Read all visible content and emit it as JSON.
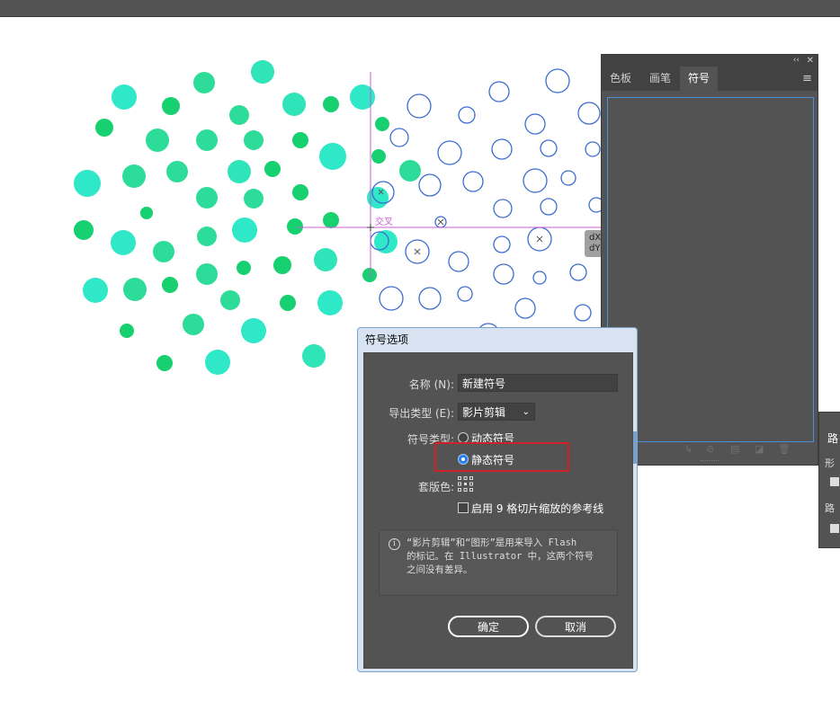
{
  "canvas": {
    "smart_guide_label": "交叉"
  },
  "dx_tooltip": {
    "dx": "dX",
    "dy": "dY"
  },
  "panel": {
    "tabs": [
      {
        "label": "色板"
      },
      {
        "label": "画笔"
      },
      {
        "label": "符号",
        "active": true
      }
    ],
    "collapse_icon": "double-chevron-left-icon",
    "close_icon": "close-icon",
    "menu_icon": "hamburger-menu-icon",
    "footer_icons": [
      "place-symbol-icon",
      "break-link-icon",
      "symbol-options-icon",
      "new-symbol-icon",
      "delete-icon"
    ]
  },
  "right_panel": {
    "title": "路",
    "label1": "形",
    "label2": "路"
  },
  "dialog": {
    "title": "符号选项",
    "name_label": "名称 (N):",
    "name_value": "新建符号",
    "export_label": "导出类型 (E):",
    "export_value": "影片剪辑",
    "symbol_type_label": "符号类型:",
    "dynamic_label": "动态符号",
    "static_label": "静态符号",
    "selected_type": "静态符号",
    "registration_label": "套版色:",
    "nine_slice_label": "启用 9 格切片缩放的参考线",
    "nine_slice_checked": false,
    "info_text": "“影片剪辑”和“图形”是用来导入 Flash\n的标记。在 Illustrator 中，这两个符号\n之间没有差异。",
    "ok_label": "确定",
    "cancel_label": "取消",
    "highlight_color": "#d0202a",
    "accent_color": "#2680eb"
  }
}
